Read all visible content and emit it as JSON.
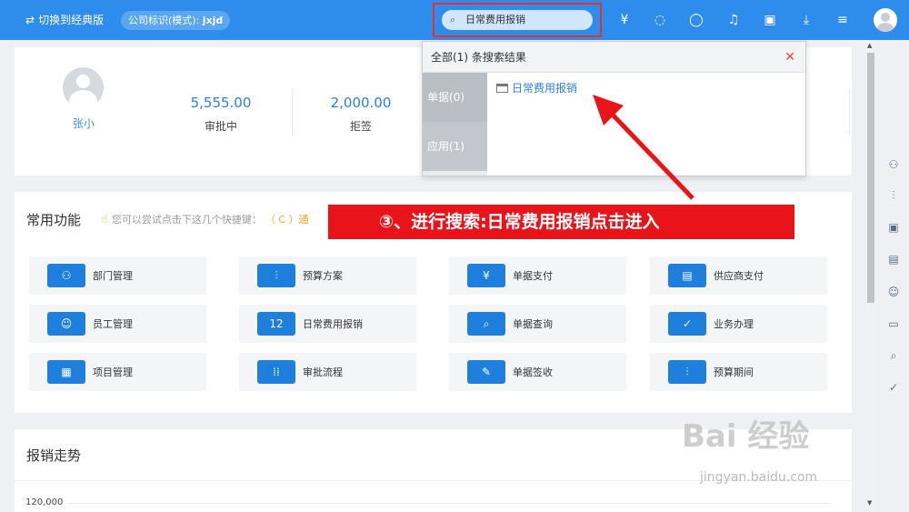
{
  "topbar": {
    "switch_label": "切换到经典版",
    "company_label": "公司标识(模式):",
    "company_value": "jxjd",
    "search_value": "日常费用报销",
    "icons": [
      "receipt-icon",
      "wechat-icon",
      "qq-icon",
      "bell-icon",
      "contact-card-icon",
      "download-icon",
      "menu-icon",
      "user-avatar"
    ]
  },
  "profile": {
    "name": "张小"
  },
  "stats": [
    {
      "value": "5,555.00",
      "label": "审批中"
    },
    {
      "value": "2,000.00",
      "label": "拒签"
    }
  ],
  "search_dropdown": {
    "header": "全部(1) 条搜索结果",
    "tabs": [
      "单据(0)",
      "应用(1)"
    ],
    "result": "日常费用报销"
  },
  "banner": {
    "text": "③、进行搜索:日常费用报销点击进入"
  },
  "functions": {
    "title": "常用功能",
    "hint_prefix": "您可以尝试点击下这几个快捷键：",
    "hint_key": "（ C ）通",
    "items": [
      {
        "label": "部门管理",
        "icon": "org-chart-icon"
      },
      {
        "label": "预算方案",
        "icon": "sliders-icon"
      },
      {
        "label": "单据支付",
        "icon": "payment-icon"
      },
      {
        "label": "供应商支付",
        "icon": "supplier-pay-icon"
      },
      {
        "label": "员工管理",
        "icon": "employee-icon"
      },
      {
        "label": "日常费用报销",
        "icon": "expense-icon"
      },
      {
        "label": "单据查询",
        "icon": "document-search-icon"
      },
      {
        "label": "业务办理",
        "icon": "check-icon"
      },
      {
        "label": "项目管理",
        "icon": "project-icon"
      },
      {
        "label": "审批流程",
        "icon": "approval-flow-icon"
      },
      {
        "label": "单据签收",
        "icon": "sign-icon"
      },
      {
        "label": "预算期间",
        "icon": "budget-period-icon"
      }
    ]
  },
  "trend": {
    "title": "报销走势",
    "y_tick": "120,000"
  },
  "watermark": {
    "main": "Bai 经验",
    "sub": "jingyan.baidu.com"
  },
  "colors": {
    "accent": "#2e8cec",
    "banner": "#e8141a",
    "icon_bg": "#1e7fdc"
  }
}
